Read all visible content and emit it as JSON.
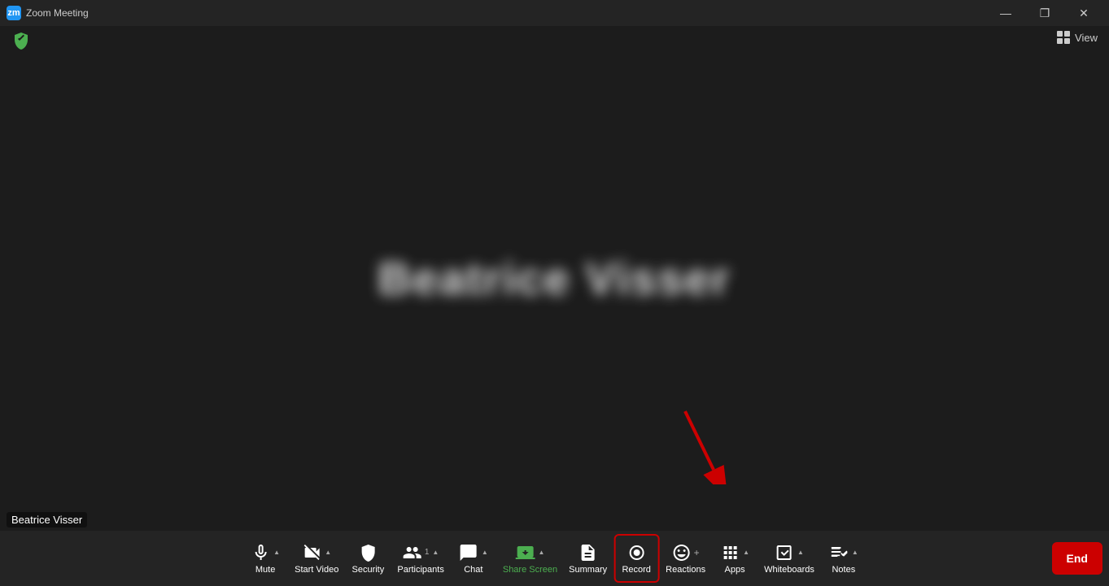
{
  "titleBar": {
    "title": "Zoom Meeting",
    "logoText": "zm",
    "controls": {
      "minimize": "—",
      "maximize": "❐",
      "close": "✕"
    }
  },
  "topBar": {
    "shieldIcon": "shield",
    "viewLabel": "View"
  },
  "mainContent": {
    "participantName": "Beatrice Visser",
    "blurredText": "Beatrice Visser"
  },
  "bottomLabel": {
    "name": "Beatrice Visser"
  },
  "toolbar": {
    "tools": [
      {
        "id": "mute",
        "label": "Mute",
        "hasCaret": true,
        "green": false
      },
      {
        "id": "start-video",
        "label": "Start Video",
        "hasCaret": true,
        "green": false
      },
      {
        "id": "security",
        "label": "Security",
        "hasCaret": false,
        "green": false
      },
      {
        "id": "participants",
        "label": "Participants",
        "hasCaret": true,
        "green": false,
        "count": "1"
      },
      {
        "id": "chat",
        "label": "Chat",
        "hasCaret": true,
        "green": false
      },
      {
        "id": "share-screen",
        "label": "Share Screen",
        "hasCaret": true,
        "green": true
      },
      {
        "id": "summary",
        "label": "Summary",
        "hasCaret": false,
        "green": false
      },
      {
        "id": "record",
        "label": "Record",
        "hasCaret": false,
        "green": false,
        "highlighted": true
      },
      {
        "id": "reactions",
        "label": "Reactions",
        "hasCaret": false,
        "green": false
      },
      {
        "id": "apps",
        "label": "Apps",
        "hasCaret": true,
        "green": false
      },
      {
        "id": "whiteboards",
        "label": "Whiteboards",
        "hasCaret": true,
        "green": false
      },
      {
        "id": "notes",
        "label": "Notes",
        "hasCaret": true,
        "green": false
      }
    ],
    "endButton": "End"
  },
  "colors": {
    "accent": "#4caf50",
    "highlight": "#cc0000",
    "bg": "#242424",
    "mainBg": "#1c1c1c"
  }
}
